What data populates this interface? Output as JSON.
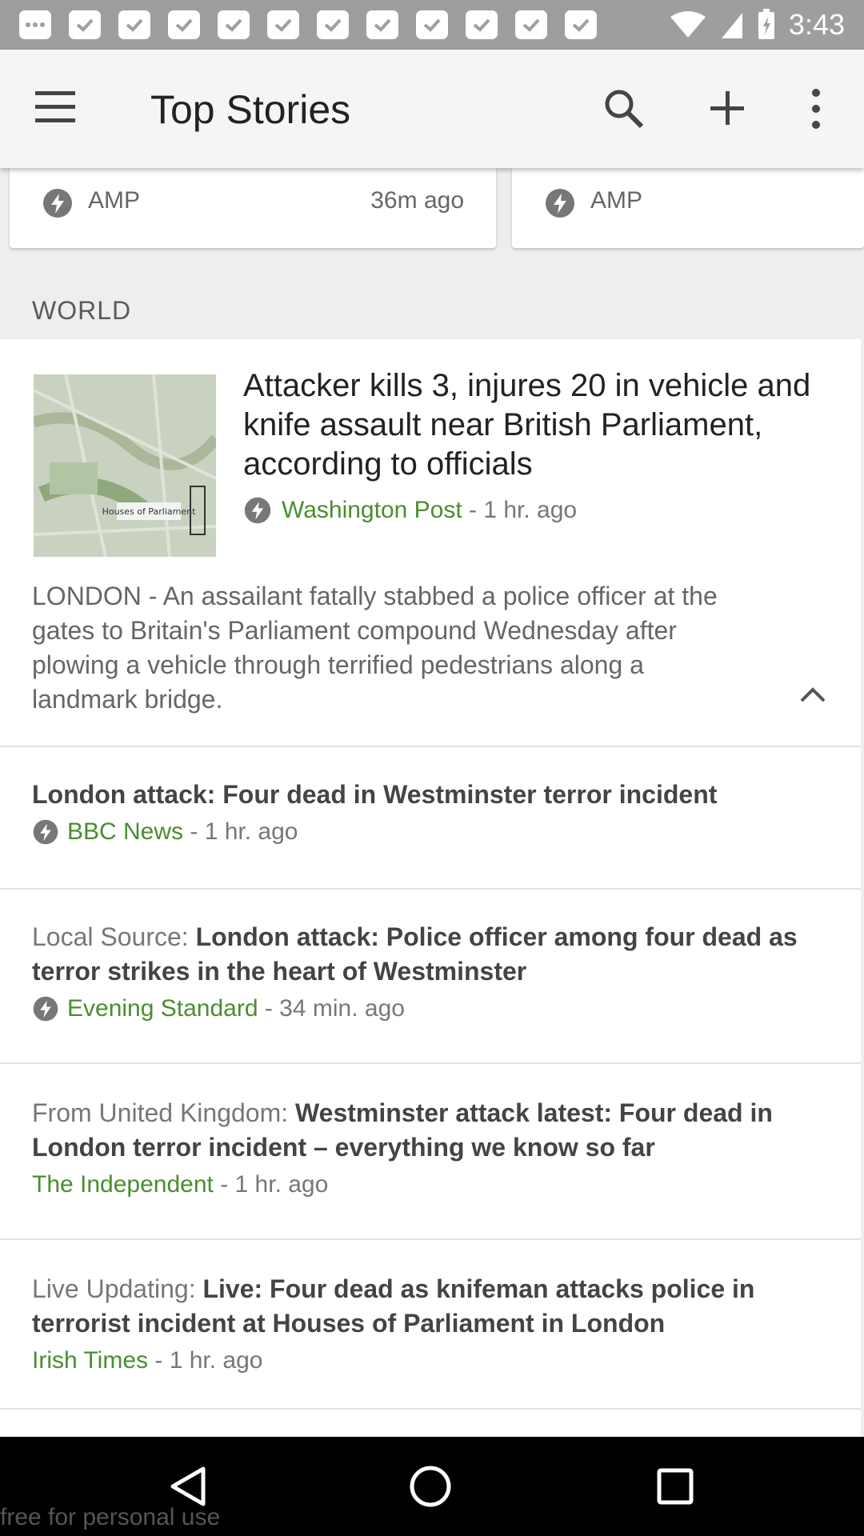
{
  "status_bar": {
    "notification_icons": [
      "message-icon",
      "tasks-icon",
      "tasks-icon",
      "tasks-icon",
      "tasks-icon",
      "tasks-icon",
      "tasks-icon",
      "tasks-icon",
      "tasks-icon",
      "tasks-icon",
      "tasks-icon",
      "tasks-icon"
    ],
    "time": "3:43"
  },
  "app_bar": {
    "title": "Top Stories",
    "actions": [
      "menu-icon",
      "search-icon",
      "add-icon",
      "more-vert-icon"
    ]
  },
  "amp_cards": [
    {
      "label": "AMP",
      "time": "36m ago"
    },
    {
      "label": "AMP",
      "time": ""
    }
  ],
  "section": {
    "title": "WORLD"
  },
  "main_story": {
    "headline": "Attacker kills 3, injures 20 in vehicle and knife assault near British Parliament, according to officials",
    "source": "Washington Post",
    "time": " - 1 hr. ago",
    "snippet": "LONDON - An assailant fatally stabbed a police officer at the gates to Britain's Parliament compound Wednesday after plowing a vehicle through terrified pedestrians along a landmark bridge.",
    "image_label": "Houses of Parliament"
  },
  "related": [
    {
      "prefix": "",
      "title": "London attack: Four dead in Westminster terror incident",
      "source": "BBC News",
      "time": " - 1 hr. ago",
      "amp": true
    },
    {
      "prefix": "Local Source: ",
      "title": "London attack: Police officer among four dead as terror strikes in the heart of Westminster",
      "source": "Evening Standard",
      "time": " - 34 min. ago",
      "amp": true
    },
    {
      "prefix": "From United Kingdom: ",
      "title": "Westminster attack latest: Four dead in London terror incident – everything we know so far",
      "source": "The Independent",
      "time": " - 1 hr. ago",
      "amp": false
    },
    {
      "prefix": "Live Updating: ",
      "title": "Live: Four dead as knifeman attacks police in terrorist incident at Houses of Parliament in London",
      "source": "Irish Times",
      "time": " - 1 hr. ago",
      "amp": false
    }
  ],
  "nav_bar": {
    "buttons": [
      "back-icon",
      "home-icon",
      "recents-icon"
    ]
  },
  "watermark": "free for personal use",
  "colors": {
    "source_green": "#4a8d2f",
    "app_bar": "#f5f5f5",
    "status_bar": "#9e9e9e"
  }
}
